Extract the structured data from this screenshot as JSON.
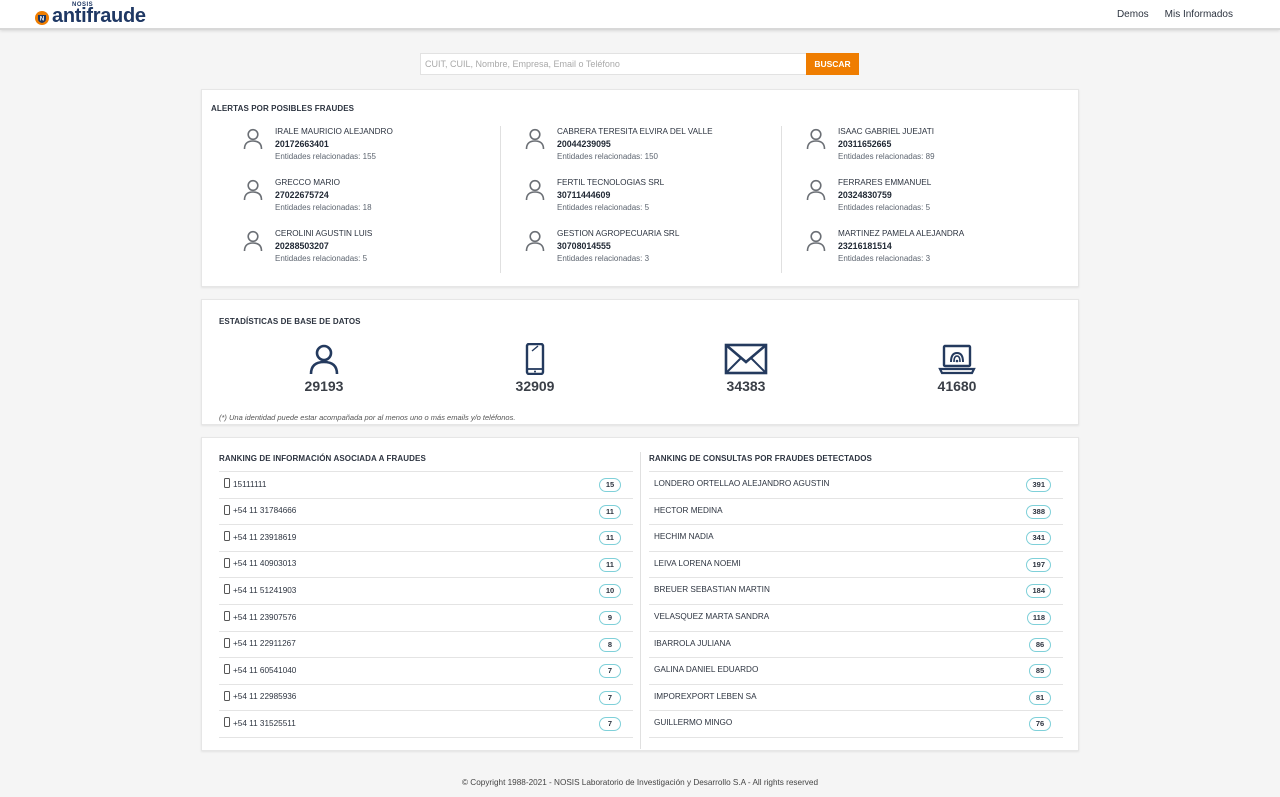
{
  "brand": {
    "small": "NOSIS",
    "name": "antifraude",
    "accent": "#ef7d00",
    "primary": "#1f3864"
  },
  "nav": {
    "demos": "Demos",
    "mis_informados": "Mis Informados"
  },
  "search": {
    "placeholder": "CUIT, CUIL, Nombre, Empresa, Email o Teléfono",
    "button": "BUSCAR"
  },
  "alerts": {
    "title": "ALERTAS POR POSIBLES FRAUDES",
    "items": [
      {
        "name": "IRALE MAURICIO ALEJANDRO",
        "id": "20172663401",
        "entities": "Entidades relacionadas: 155"
      },
      {
        "name": "CABRERA TERESITA ELVIRA DEL VALLE",
        "id": "20044239095",
        "entities": "Entidades relacionadas: 150"
      },
      {
        "name": "ISAAC GABRIEL JUEJATI",
        "id": "20311652665",
        "entities": "Entidades relacionadas: 89"
      },
      {
        "name": "GRECCO MARIO",
        "id": "27022675724",
        "entities": "Entidades relacionadas: 18"
      },
      {
        "name": "FERTIL TECNOLOGIAS SRL",
        "id": "30711444609",
        "entities": "Entidades relacionadas: 5"
      },
      {
        "name": "FERRARES EMMANUEL",
        "id": "20324830759",
        "entities": "Entidades relacionadas: 5"
      },
      {
        "name": "CEROLINI AGUSTIN LUIS",
        "id": "20288503207",
        "entities": "Entidades relacionadas: 5"
      },
      {
        "name": "GESTION AGROPECUARIA SRL",
        "id": "30708014555",
        "entities": "Entidades relacionadas: 3"
      },
      {
        "name": "MARTINEZ PAMELA ALEJANDRA",
        "id": "23216181514",
        "entities": "Entidades relacionadas: 3"
      }
    ]
  },
  "stats": {
    "title": "ESTADÍSTICAS DE BASE DE DATOS",
    "items": [
      {
        "icon": "person-icon",
        "value": "29193"
      },
      {
        "icon": "phone-icon",
        "value": "32909"
      },
      {
        "icon": "envelope-icon",
        "value": "34383"
      },
      {
        "icon": "laptop-icon",
        "value": "41680"
      }
    ],
    "footnote": "(*) Una identidad puede estar acompañada por al menos uno o más emails y/o teléfonos."
  },
  "ranking_info": {
    "title": "RANKING DE INFORMACIÓN ASOCIADA A FRAUDES",
    "rows": [
      {
        "label": "15111111",
        "count": "15"
      },
      {
        "label": "+54 11 31784666",
        "count": "11"
      },
      {
        "label": "+54 11 23918619",
        "count": "11"
      },
      {
        "label": "+54 11 40903013",
        "count": "11"
      },
      {
        "label": "+54 11 51241903",
        "count": "10"
      },
      {
        "label": "+54 11 23907576",
        "count": "9"
      },
      {
        "label": "+54 11 22911267",
        "count": "8"
      },
      {
        "label": "+54 11 60541040",
        "count": "7"
      },
      {
        "label": "+54 11 22985936",
        "count": "7"
      },
      {
        "label": "+54 11 31525511",
        "count": "7"
      }
    ]
  },
  "ranking_queries": {
    "title": "RANKING DE CONSULTAS POR FRAUDES DETECTADOS",
    "rows": [
      {
        "label": "LONDERO ORTELLAO ALEJANDRO AGUSTIN",
        "count": "391"
      },
      {
        "label": "HECTOR MEDINA",
        "count": "388"
      },
      {
        "label": "HECHIM NADIA",
        "count": "341"
      },
      {
        "label": "LEIVA LORENA NOEMI",
        "count": "197"
      },
      {
        "label": "BREUER SEBASTIAN MARTIN",
        "count": "184"
      },
      {
        "label": "VELASQUEZ MARTA SANDRA",
        "count": "118"
      },
      {
        "label": "IBARROLA JULIANA",
        "count": "86"
      },
      {
        "label": "GALINA DANIEL EDUARDO",
        "count": "85"
      },
      {
        "label": "IMPOREXPORT LEBEN SA",
        "count": "81"
      },
      {
        "label": "GUILLERMO MINGO",
        "count": "76"
      }
    ]
  },
  "footer": "© Copyright 1988-2021 - NOSIS Laboratorio de Investigación y Desarrollo S.A - All rights reserved"
}
